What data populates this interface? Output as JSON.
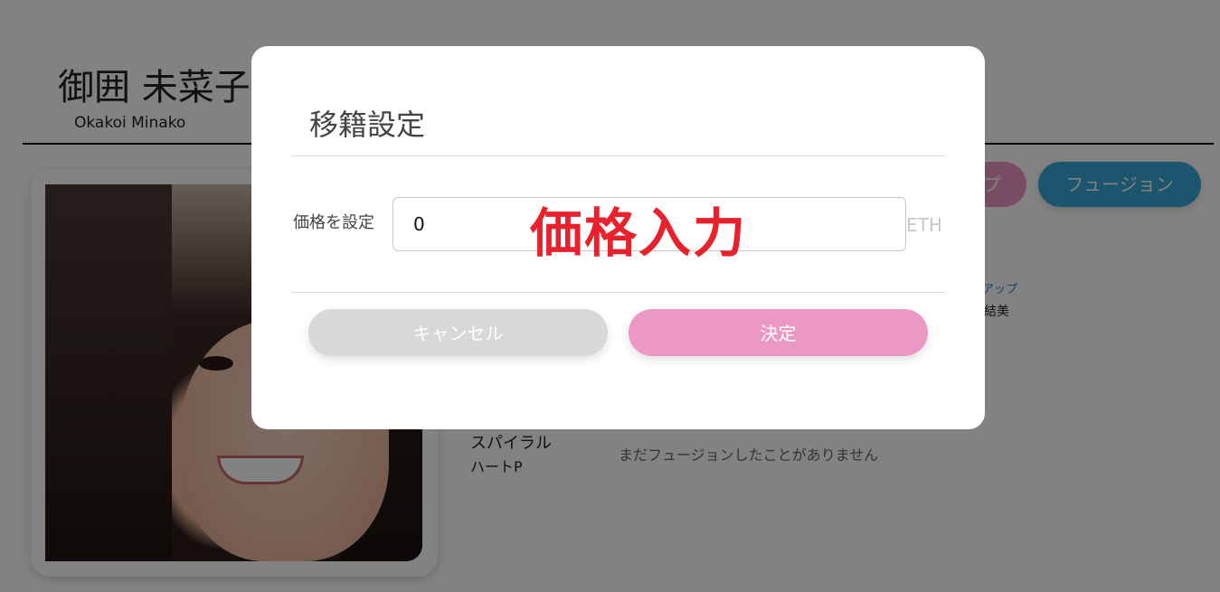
{
  "profile": {
    "name_ja": "御囲 未菜子",
    "name_en": "Okakoi Minako",
    "photo_icon": "idol-portrait-photo"
  },
  "actions": {
    "pink_button_label": "プ",
    "fusion_button_label": "フュージョン"
  },
  "details": {
    "link_up": "アップ",
    "partner": "結美",
    "skill_name": "スパイラル",
    "skill_sub": "ハートP",
    "fusion_empty": "まだフュージョンしたことがありません"
  },
  "modal": {
    "title": "移籍設定",
    "price_label": "価格を設定",
    "price_value": "0",
    "unit": "ETH",
    "overlay_caption": "価格入力",
    "cancel_label": "キャンセル",
    "confirm_label": "決定"
  },
  "colors": {
    "confirm": "#eb98c5",
    "cancel": "#d8d8d8",
    "fusion": "#38a8d8",
    "caption": "#e8212d"
  }
}
